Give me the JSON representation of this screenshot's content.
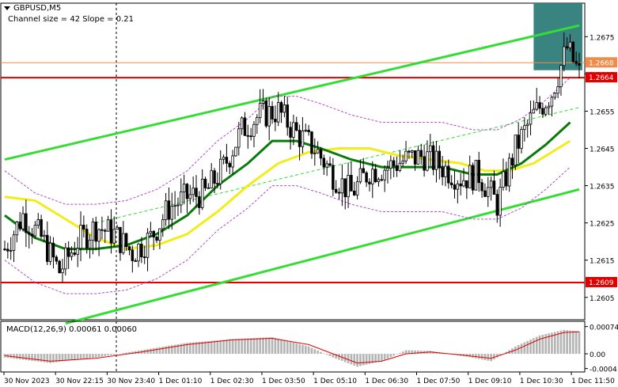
{
  "header": {
    "symbol": "GBPUSD,M5",
    "indicator": "Channel size = 42 Slope = 0.21",
    "dropdown_icon": "triangle-down-icon"
  },
  "colors": {
    "bull": "#000000",
    "bear": "#000000",
    "ma_fast": "#0a7a0a",
    "ma_slow": "#f2ec19",
    "envelope": "#b04cc9",
    "channel": "#33dd33",
    "level_red": "#e00000",
    "level_orange": "#f08c4a",
    "highlight": "#2e7d7a",
    "macd_hist": "#b5b5b5",
    "macd_signal": "#e00000"
  },
  "chart_data": {
    "type": "candlestick",
    "instrument": "GBPUSD",
    "timeframe": "M5",
    "ylim": [
      1.2599,
      1.2684
    ],
    "y_ticks": [
      "1.2675",
      "1.2665",
      "1.2655",
      "1.2645",
      "1.2635",
      "1.2625",
      "1.2615",
      "1.2605"
    ],
    "x_ticks": [
      "30 Nov 2023",
      "30 Nov 22:15",
      "30 Nov 23:40",
      "1 Dec 01:10",
      "1 Dec 02:30",
      "1 Dec 03:50",
      "1 Dec 05:10",
      "1 Dec 06:30",
      "1 Dec 07:50",
      "1 Dec 09:10",
      "1 Dec 10:30",
      "1 Dec 11:50"
    ],
    "price_labels": [
      {
        "text": "1.2668",
        "value": 1.2668,
        "style": "orange"
      },
      {
        "text": "1.2664",
        "value": 1.2664,
        "style": "red"
      },
      {
        "text": "1.2609",
        "value": 1.2609,
        "style": "red"
      }
    ],
    "close_path": [
      [
        0,
        1.2618
      ],
      [
        6,
        1.2627
      ],
      [
        12,
        1.2621
      ],
      [
        18,
        1.2612
      ],
      [
        24,
        1.262
      ],
      [
        30,
        1.2624
      ],
      [
        36,
        1.2622
      ],
      [
        42,
        1.2617
      ],
      [
        48,
        1.2621
      ],
      [
        54,
        1.2629
      ],
      [
        60,
        1.2632
      ],
      [
        66,
        1.2633
      ],
      [
        72,
        1.264
      ],
      [
        78,
        1.265
      ],
      [
        84,
        1.2654
      ],
      [
        90,
        1.2655
      ],
      [
        96,
        1.2649
      ],
      [
        102,
        1.2645
      ],
      [
        108,
        1.2638
      ],
      [
        114,
        1.2633
      ],
      [
        120,
        1.2639
      ],
      [
        126,
        1.264
      ],
      [
        132,
        1.2642
      ],
      [
        138,
        1.2643
      ],
      [
        144,
        1.264
      ],
      [
        150,
        1.2637
      ],
      [
        156,
        1.2638
      ],
      [
        162,
        1.263
      ],
      [
        168,
        1.2645
      ],
      [
        174,
        1.2654
      ],
      [
        180,
        1.266
      ],
      [
        185,
        1.2672
      ],
      [
        189,
        1.2665
      ]
    ],
    "ma_fast_path": [
      [
        0,
        1.2627
      ],
      [
        10,
        1.2621
      ],
      [
        20,
        1.2618
      ],
      [
        30,
        1.2618
      ],
      [
        40,
        1.2619
      ],
      [
        50,
        1.2622
      ],
      [
        60,
        1.2627
      ],
      [
        70,
        1.2635
      ],
      [
        80,
        1.2641
      ],
      [
        88,
        1.2647
      ],
      [
        96,
        1.2647
      ],
      [
        104,
        1.2645
      ],
      [
        114,
        1.2642
      ],
      [
        124,
        1.264
      ],
      [
        134,
        1.264
      ],
      [
        144,
        1.264
      ],
      [
        154,
        1.2638
      ],
      [
        162,
        1.2638
      ],
      [
        170,
        1.2641
      ],
      [
        178,
        1.2646
      ],
      [
        186,
        1.2652
      ]
    ],
    "ma_slow_path": [
      [
        0,
        1.2632
      ],
      [
        10,
        1.2631
      ],
      [
        20,
        1.2626
      ],
      [
        30,
        1.2621
      ],
      [
        40,
        1.2618
      ],
      [
        50,
        1.2619
      ],
      [
        60,
        1.2622
      ],
      [
        70,
        1.2628
      ],
      [
        80,
        1.2635
      ],
      [
        90,
        1.2641
      ],
      [
        100,
        1.2644
      ],
      [
        110,
        1.2645
      ],
      [
        120,
        1.2645
      ],
      [
        130,
        1.2643
      ],
      [
        140,
        1.2642
      ],
      [
        150,
        1.2641
      ],
      [
        158,
        1.2639
      ],
      [
        166,
        1.2639
      ],
      [
        174,
        1.2641
      ],
      [
        182,
        1.2645
      ],
      [
        186,
        1.2647
      ]
    ],
    "channel_upper": [
      [
        0,
        1.2642
      ],
      [
        189,
        1.2678
      ]
    ],
    "channel_lower": [
      [
        20,
        1.2598
      ],
      [
        189,
        1.2634
      ]
    ],
    "channel_mid": [
      [
        30,
        1.2625
      ],
      [
        189,
        1.2656
      ]
    ],
    "highlight_zone": {
      "x_from": 174,
      "x_to": 189,
      "y_from": 1.2666,
      "y_to": 1.2684
    },
    "macd": {
      "label": "MACD(12,26,9) 0.00061 0.00060",
      "ylim": [
        -0.00045,
        0.00084
      ],
      "y_ticks": [
        "0.00074",
        "0.00",
        "-0.0004"
      ],
      "hist_path": [
        [
          0,
          -0.0001
        ],
        [
          15,
          -0.00025
        ],
        [
          30,
          -0.0001
        ],
        [
          45,
          0.0001
        ],
        [
          60,
          0.0003
        ],
        [
          75,
          0.0004
        ],
        [
          88,
          0.00045
        ],
        [
          100,
          0.0002
        ],
        [
          108,
          -0.0001
        ],
        [
          116,
          -0.00035
        ],
        [
          124,
          -0.0002
        ],
        [
          132,
          0.0001
        ],
        [
          140,
          8e-05
        ],
        [
          150,
          -5e-05
        ],
        [
          160,
          -0.0002
        ],
        [
          168,
          0.0002
        ],
        [
          176,
          0.0005
        ],
        [
          184,
          0.00065
        ],
        [
          189,
          0.00061
        ]
      ],
      "signal_path": [
        [
          0,
          -5e-05
        ],
        [
          15,
          -0.0002
        ],
        [
          30,
          -0.00012
        ],
        [
          45,
          5e-05
        ],
        [
          60,
          0.00025
        ],
        [
          75,
          0.00038
        ],
        [
          88,
          0.00042
        ],
        [
          100,
          0.00025
        ],
        [
          108,
          0.0
        ],
        [
          116,
          -0.00025
        ],
        [
          124,
          -0.0002
        ],
        [
          132,
          0.0
        ],
        [
          140,
          5e-05
        ],
        [
          150,
          -3e-05
        ],
        [
          160,
          -0.00012
        ],
        [
          168,
          0.0001
        ],
        [
          176,
          0.0004
        ],
        [
          184,
          0.00058
        ],
        [
          189,
          0.0006
        ]
      ]
    }
  }
}
